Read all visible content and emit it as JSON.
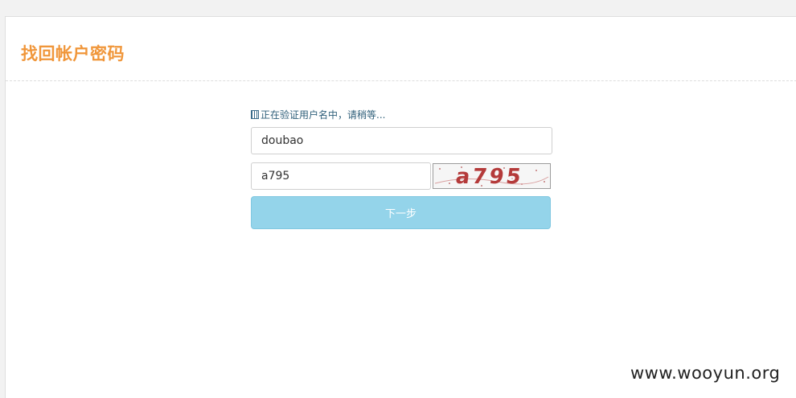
{
  "page": {
    "title": "找回帐户密码",
    "status_text": "正在验证用户名中，请稍等..."
  },
  "form": {
    "username_value": "doubao",
    "captcha_value": "a795",
    "captcha_image_text": "a795",
    "next_button_label": "下一步"
  },
  "watermark": "www.wooyun.org",
  "colors": {
    "title": "#f0963a",
    "button": "#94d4ea",
    "status": "#2f5f7a"
  }
}
